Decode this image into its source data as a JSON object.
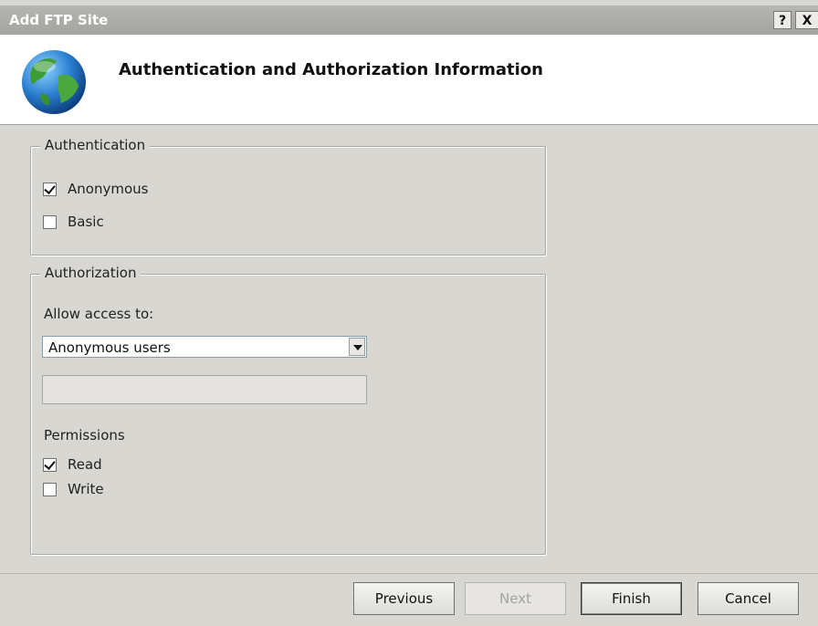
{
  "window": {
    "title": "Add FTP Site",
    "help_label": "?",
    "close_label": "X"
  },
  "header": {
    "title": "Authentication and Authorization Information",
    "icon": "globe-icon"
  },
  "authentication": {
    "legend": "Authentication",
    "anonymous": {
      "label": "Anonymous",
      "checked": true
    },
    "basic": {
      "label": "Basic",
      "checked": false
    }
  },
  "authorization": {
    "legend": "Authorization",
    "allow_label": "Allow access to:",
    "allow_value": "Anonymous users",
    "allow_extra_value": "",
    "permissions_label": "Permissions",
    "read": {
      "label": "Read",
      "checked": true
    },
    "write": {
      "label": "Write",
      "checked": false
    }
  },
  "buttons": {
    "previous": "Previous",
    "next": "Next",
    "finish": "Finish",
    "cancel": "Cancel"
  }
}
